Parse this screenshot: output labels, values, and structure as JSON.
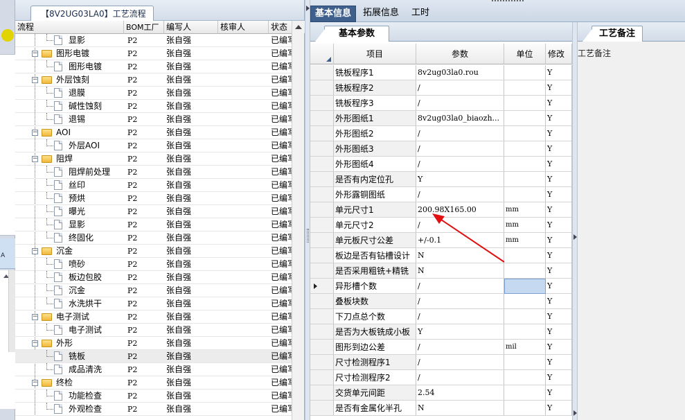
{
  "left_strip": {
    "band_label": "A"
  },
  "tree": {
    "tab_title": "【8V2UG03LA0】工艺流程",
    "columns": [
      "流程",
      "BOM工厂",
      "编写人",
      "核审人",
      "状态"
    ],
    "rows": [
      {
        "label": "显影",
        "type": "doc",
        "level": 2,
        "factory": "P2",
        "writer": "张自强",
        "reviewer": "",
        "status": "已编写"
      },
      {
        "label": "图形电镀",
        "type": "folder",
        "level": 1,
        "factory": "P2",
        "writer": "张自强",
        "reviewer": "",
        "status": "已编写"
      },
      {
        "label": "图形电镀",
        "type": "doc",
        "level": 2,
        "factory": "P2",
        "writer": "张自强",
        "reviewer": "",
        "status": "已编写"
      },
      {
        "label": "外层蚀刻",
        "type": "folder",
        "level": 1,
        "factory": "P2",
        "writer": "张自强",
        "reviewer": "",
        "status": "已编写"
      },
      {
        "label": "退膜",
        "type": "doc",
        "level": 2,
        "factory": "P2",
        "writer": "张自强",
        "reviewer": "",
        "status": "已编写"
      },
      {
        "label": "碱性蚀刻",
        "type": "doc",
        "level": 2,
        "factory": "P2",
        "writer": "张自强",
        "reviewer": "",
        "status": "已编写"
      },
      {
        "label": "退锡",
        "type": "doc",
        "level": 2,
        "factory": "P2",
        "writer": "张自强",
        "reviewer": "",
        "status": "已编写"
      },
      {
        "label": "AOI",
        "type": "folder",
        "level": 1,
        "factory": "P2",
        "writer": "张自强",
        "reviewer": "",
        "status": "已编写"
      },
      {
        "label": "外层AOI",
        "type": "doc",
        "level": 2,
        "factory": "P2",
        "writer": "张自强",
        "reviewer": "",
        "status": "已编写"
      },
      {
        "label": "阻焊",
        "type": "folder",
        "level": 1,
        "factory": "P2",
        "writer": "张自强",
        "reviewer": "",
        "status": "已编写"
      },
      {
        "label": "阻焊前处理",
        "type": "doc",
        "level": 2,
        "factory": "P2",
        "writer": "张自强",
        "reviewer": "",
        "status": "已编写"
      },
      {
        "label": "丝印",
        "type": "doc",
        "level": 2,
        "factory": "P2",
        "writer": "张自强",
        "reviewer": "",
        "status": "已编写"
      },
      {
        "label": "预烘",
        "type": "doc",
        "level": 2,
        "factory": "P2",
        "writer": "张自强",
        "reviewer": "",
        "status": "已编写"
      },
      {
        "label": "曝光",
        "type": "doc",
        "level": 2,
        "factory": "P2",
        "writer": "张自强",
        "reviewer": "",
        "status": "已编写"
      },
      {
        "label": "显影",
        "type": "doc",
        "level": 2,
        "factory": "P2",
        "writer": "张自强",
        "reviewer": "",
        "status": "已编写"
      },
      {
        "label": "终固化",
        "type": "doc",
        "level": 2,
        "factory": "P2",
        "writer": "张自强",
        "reviewer": "",
        "status": "已编写"
      },
      {
        "label": "沉金",
        "type": "folder",
        "level": 1,
        "factory": "P2",
        "writer": "张自强",
        "reviewer": "",
        "status": "已编写"
      },
      {
        "label": "喷砂",
        "type": "doc",
        "level": 2,
        "factory": "P2",
        "writer": "张自强",
        "reviewer": "",
        "status": "已编写"
      },
      {
        "label": "板边包胶",
        "type": "doc",
        "level": 2,
        "factory": "P2",
        "writer": "张自强",
        "reviewer": "",
        "status": "已编写"
      },
      {
        "label": "沉金",
        "type": "doc",
        "level": 2,
        "factory": "P2",
        "writer": "张自强",
        "reviewer": "",
        "status": "已编写"
      },
      {
        "label": "水洗烘干",
        "type": "doc",
        "level": 2,
        "factory": "P2",
        "writer": "张自强",
        "reviewer": "",
        "status": "已编写"
      },
      {
        "label": "电子测试",
        "type": "folder",
        "level": 1,
        "factory": "P2",
        "writer": "张自强",
        "reviewer": "",
        "status": "已编写"
      },
      {
        "label": "电子测试",
        "type": "doc",
        "level": 2,
        "factory": "P2",
        "writer": "张自强",
        "reviewer": "",
        "status": "已编写"
      },
      {
        "label": "外形",
        "type": "folder",
        "level": 1,
        "factory": "P2",
        "writer": "张自强",
        "reviewer": "",
        "status": "已编写"
      },
      {
        "label": "铣板",
        "type": "doc",
        "level": 2,
        "factory": "P2",
        "writer": "张自强",
        "reviewer": "",
        "status": "已编写",
        "selected": true
      },
      {
        "label": "成品清洗",
        "type": "doc",
        "level": 2,
        "factory": "P2",
        "writer": "张自强",
        "reviewer": "",
        "status": "已编写"
      },
      {
        "label": "终检",
        "type": "folder",
        "level": 1,
        "factory": "P2",
        "writer": "张自强",
        "reviewer": "",
        "status": "已编写"
      },
      {
        "label": "功能检查",
        "type": "doc",
        "level": 2,
        "factory": "P2",
        "writer": "张自强",
        "reviewer": "",
        "status": "已编写"
      },
      {
        "label": "外观检查",
        "type": "doc",
        "level": 2,
        "factory": "P2",
        "writer": "张自强",
        "reviewer": "",
        "status": "已编写"
      }
    ]
  },
  "top_tabs": [
    "基本信息",
    "拓展信息",
    "工时"
  ],
  "params": {
    "sub_tab": "基本参数",
    "columns": [
      "项目",
      "参数",
      "单位",
      "修改"
    ],
    "rows": [
      {
        "item": "铣板程序1",
        "value": "8v2ug03la0.rou",
        "unit": "",
        "mod": "Y"
      },
      {
        "item": "铣板程序2",
        "value": "/",
        "unit": "",
        "mod": "Y"
      },
      {
        "item": "铣板程序3",
        "value": "/",
        "unit": "",
        "mod": "Y"
      },
      {
        "item": "外形图纸1",
        "value": "8v2ug03la0_biaozh...",
        "unit": "",
        "mod": "Y"
      },
      {
        "item": "外形图纸2",
        "value": "/",
        "unit": "",
        "mod": "Y"
      },
      {
        "item": "外形图纸3",
        "value": "/",
        "unit": "",
        "mod": "Y"
      },
      {
        "item": "外形图纸4",
        "value": "/",
        "unit": "",
        "mod": "Y"
      },
      {
        "item": "是否有内定位孔",
        "value": "Y",
        "unit": "",
        "mod": "Y"
      },
      {
        "item": "外形露铜图纸",
        "value": "/",
        "unit": "",
        "mod": "Y"
      },
      {
        "item": "单元尺寸1",
        "value": "200.98X165.00",
        "unit": "mm",
        "mod": "Y"
      },
      {
        "item": "单元尺寸2",
        "value": "/",
        "unit": "mm",
        "mod": "Y"
      },
      {
        "item": "单元板尺寸公差",
        "value": "+/-0.1",
        "unit": "mm",
        "mod": "Y"
      },
      {
        "item": "板边是否有钻槽设计",
        "value": "N",
        "unit": "",
        "mod": "Y"
      },
      {
        "item": "是否采用粗铣+精铣",
        "value": "N",
        "unit": "",
        "mod": "Y"
      },
      {
        "item": "异形槽个数",
        "value": "/",
        "unit": "",
        "mod": "Y",
        "current": true
      },
      {
        "item": "叠板块数",
        "value": "/",
        "unit": "",
        "mod": "Y"
      },
      {
        "item": "下刀点总个数",
        "value": "/",
        "unit": "",
        "mod": "Y"
      },
      {
        "item": "是否为大板铣成小板",
        "value": "Y",
        "unit": "",
        "mod": "Y"
      },
      {
        "item": "图形到边公差",
        "value": "/",
        "unit": "mil",
        "mod": "Y"
      },
      {
        "item": "尺寸检测程序1",
        "value": "/",
        "unit": "",
        "mod": "Y"
      },
      {
        "item": "尺寸检测程序2",
        "value": "/",
        "unit": "",
        "mod": "Y"
      },
      {
        "item": "交货单元间距",
        "value": "2.54",
        "unit": "",
        "mod": "Y"
      },
      {
        "item": "是否有金属化半孔",
        "value": "N",
        "unit": "",
        "mod": "Y"
      }
    ]
  },
  "notes": {
    "sub_tab": "工艺备注",
    "label": "工艺备注"
  },
  "colors": {
    "accent": "#3f5f8c",
    "arrow": "#e01010",
    "selected_cell": "#c5d9f1"
  }
}
